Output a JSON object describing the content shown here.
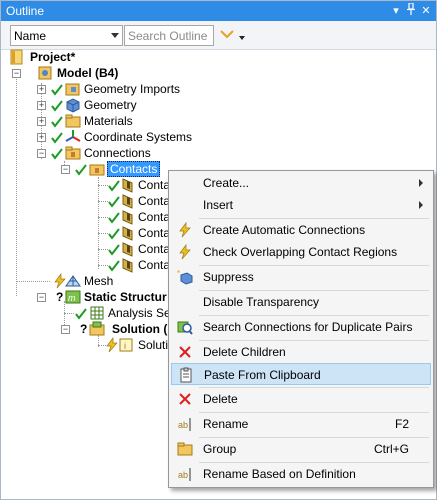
{
  "window": {
    "title": "Outline",
    "controls": [
      "▾",
      "📌",
      "✕"
    ]
  },
  "toolbar": {
    "name_select": "Name",
    "search_placeholder": "Search Outline"
  },
  "tree": {
    "project": "Project*",
    "model": "Model (B4)",
    "geometry_imports": "Geometry Imports",
    "geometry": "Geometry",
    "materials": "Materials",
    "coordinate_systems": "Coordinate Systems",
    "connections": "Connections",
    "contacts": "Contacts",
    "contact_items": [
      "Contac",
      "Contac",
      "Contac",
      "Contac",
      "Contac",
      "Contac"
    ],
    "mesh": "Mesh",
    "static_structural": "Static Structur",
    "analysis_settings": "Analysis Set",
    "solution": "Solution (",
    "solution_info": "Solutio"
  },
  "context_menu": {
    "create": "Create...",
    "insert": "Insert",
    "create_auto": "Create Automatic Connections",
    "check_overlap": "Check Overlapping Contact Regions",
    "suppress": "Suppress",
    "disable_transparency": "Disable Transparency",
    "search_duplicates": "Search Connections for Duplicate Pairs",
    "delete_children": "Delete Children",
    "paste": "Paste From Clipboard",
    "delete": "Delete",
    "rename": "Rename",
    "rename_shortcut": "F2",
    "group": "Group",
    "group_shortcut": "Ctrl+G",
    "rename_def": "Rename Based on Definition"
  },
  "colors": {
    "titlebar": "#2e8be6",
    "selection": "#3399ff",
    "menu_highlight": "#cde4f7",
    "check_green": "#1e9a1e",
    "delete_red": "#e02020"
  }
}
